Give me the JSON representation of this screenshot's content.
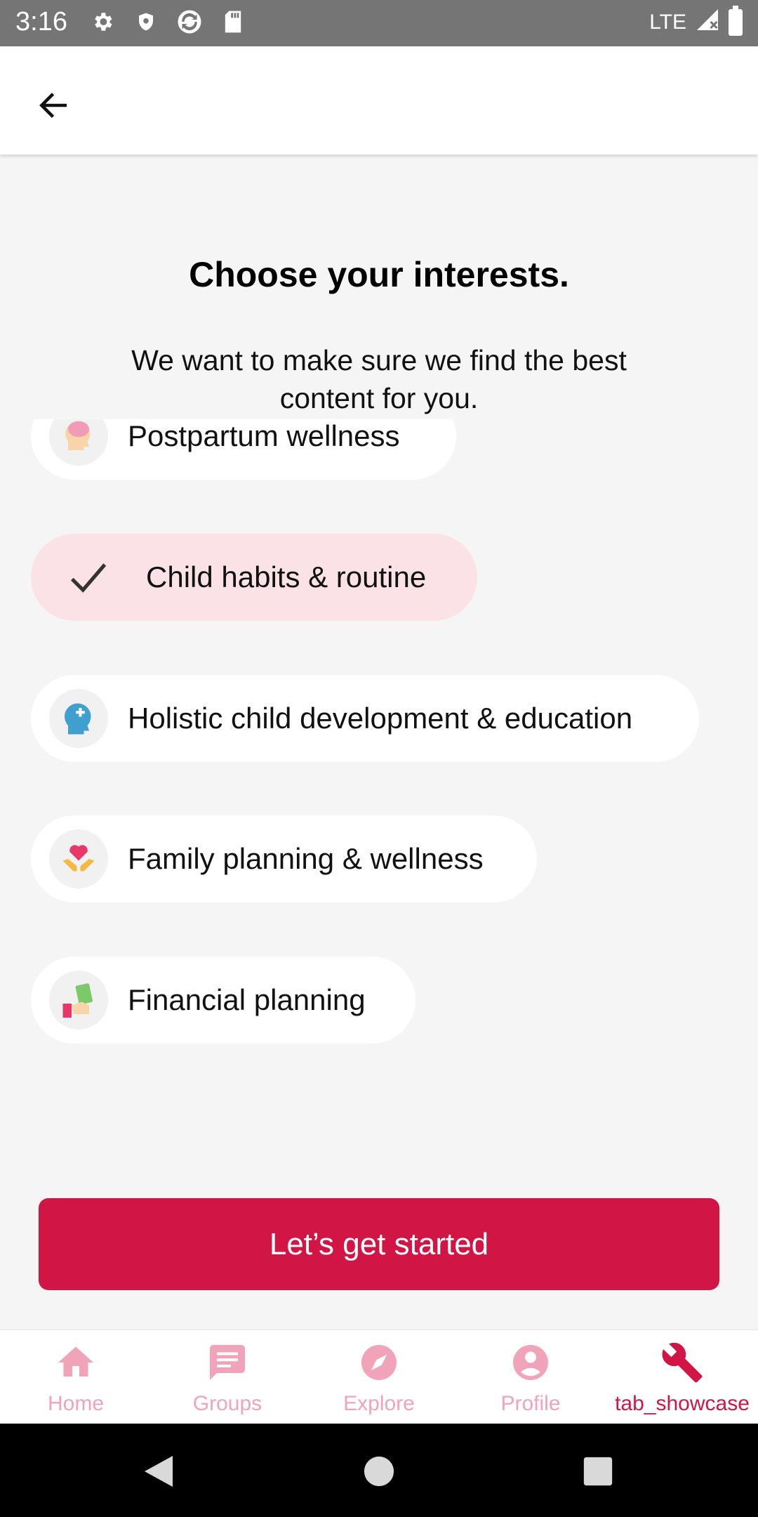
{
  "status_bar": {
    "time": "3:16",
    "network": "LTE",
    "icons": [
      "settings-icon",
      "shield-icon",
      "sync-icon",
      "sd-card-icon",
      "signal-icon",
      "battery-icon"
    ]
  },
  "app_bar": {
    "back_icon": "arrow-left-icon"
  },
  "heading": {
    "title": "Choose your interests.",
    "subtitle": "We want to make sure we find the best content for you."
  },
  "interests": [
    {
      "label": "Postpartum wellness",
      "icon": "brain-head-icon",
      "selected": false
    },
    {
      "label": "Child habits & routine",
      "icon": "check-icon",
      "selected": true
    },
    {
      "label": "Holistic child development & education",
      "icon": "head-plus-icon",
      "selected": false
    },
    {
      "label": "Family planning & wellness",
      "icon": "heart-hands-icon",
      "selected": false
    },
    {
      "label": "Financial planning",
      "icon": "money-hand-icon",
      "selected": false
    }
  ],
  "cta": {
    "label": "Let’s get started"
  },
  "bottom_nav": [
    {
      "label": "Home",
      "icon": "home-icon",
      "active": false
    },
    {
      "label": "Groups",
      "icon": "chat-icon",
      "active": false
    },
    {
      "label": "Explore",
      "icon": "compass-icon",
      "active": false
    },
    {
      "label": "Profile",
      "icon": "profile-icon",
      "active": false
    },
    {
      "label": "tab_showcase",
      "icon": "wrench-icon",
      "active": true
    }
  ],
  "colors": {
    "accent": "#d11545",
    "nav_inactive": "#f0a3b9",
    "selected_chip": "#fbe2e7",
    "status_bar": "#757575"
  }
}
